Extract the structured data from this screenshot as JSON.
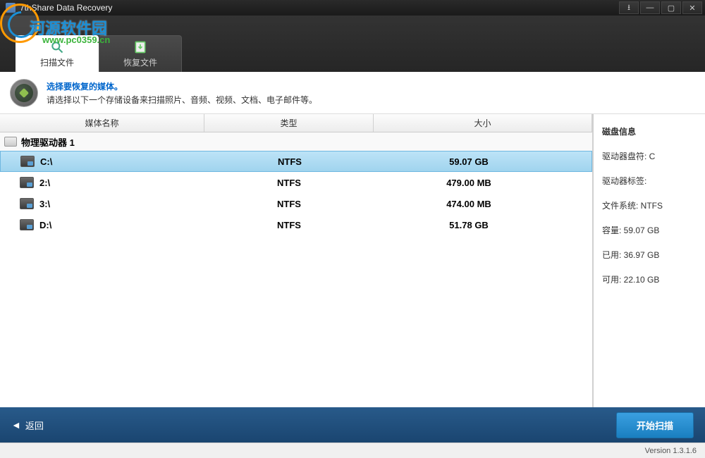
{
  "window": {
    "title": "7thShare Data Recovery"
  },
  "watermark": {
    "text": "河源软件园",
    "url": "www.pc0359.cn"
  },
  "tabs": {
    "scan": "扫描文件",
    "recover": "恢复文件"
  },
  "instruction": {
    "title": "选择要恢复的媒体。",
    "desc": "请选择以下一个存储设备来扫描照片、音频、视频、文档、电子邮件等。"
  },
  "columns": {
    "name": "媒体名称",
    "type": "类型",
    "size": "大小"
  },
  "group": "物理驱动器 1",
  "drives": [
    {
      "name": "C:\\",
      "type": "NTFS",
      "size": "59.07 GB"
    },
    {
      "name": "2:\\",
      "type": "NTFS",
      "size": "479.00 MB"
    },
    {
      "name": "3:\\",
      "type": "NTFS",
      "size": "474.00 MB"
    },
    {
      "name": "D:\\",
      "type": "NTFS",
      "size": "51.78 GB"
    }
  ],
  "disk_info": {
    "title": "磁盘信息",
    "letter_label": "驱动器盘符: ",
    "letter_value": "C",
    "label_label": "驱动器标签:",
    "label_value": "",
    "fs_label": "文件系统: ",
    "fs_value": "NTFS",
    "capacity_label": "容量: ",
    "capacity_value": "59.07 GB",
    "used_label": "已用: ",
    "used_value": "36.97 GB",
    "free_label": "可用: ",
    "free_value": "22.10 GB"
  },
  "footer": {
    "back": "返回",
    "scan": "开始扫描"
  },
  "version": "Version  1.3.1.6"
}
